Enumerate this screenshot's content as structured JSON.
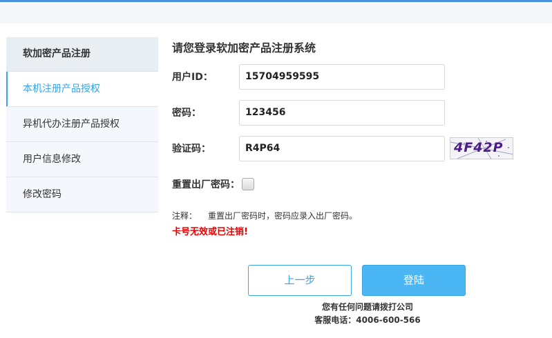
{
  "sidebar": {
    "header": "软加密产品注册",
    "items": [
      {
        "label": "本机注册产品授权",
        "active": true
      },
      {
        "label": "异机代办注册产品授权",
        "active": false
      },
      {
        "label": "用户信息修改",
        "active": false
      },
      {
        "label": "修改密码",
        "active": false
      }
    ]
  },
  "main": {
    "title": "请您登录软加密产品注册系统",
    "user_id": {
      "label": "用户ID：",
      "value": "15704959595"
    },
    "password": {
      "label": "密码：",
      "value": "123456"
    },
    "captcha": {
      "label": "验证码：",
      "value": "R4P64",
      "image_text": "4F42P"
    },
    "reset": {
      "label": "重置出厂密码：",
      "checked": false
    },
    "note": {
      "key": "注释：",
      "text": "重置出厂密码时，密码应录入出厂密码。"
    },
    "error": "卡号无效或已注销!",
    "buttons": {
      "prev": "上一步",
      "login": "登陆"
    },
    "contact": {
      "line1": "您有任何问题请拨打公司",
      "line2": "客服电话：4006-600-566"
    }
  },
  "colors": {
    "accent": "#3aa3e3",
    "login_bg": "#4ab6f3",
    "error": "#e60000"
  }
}
